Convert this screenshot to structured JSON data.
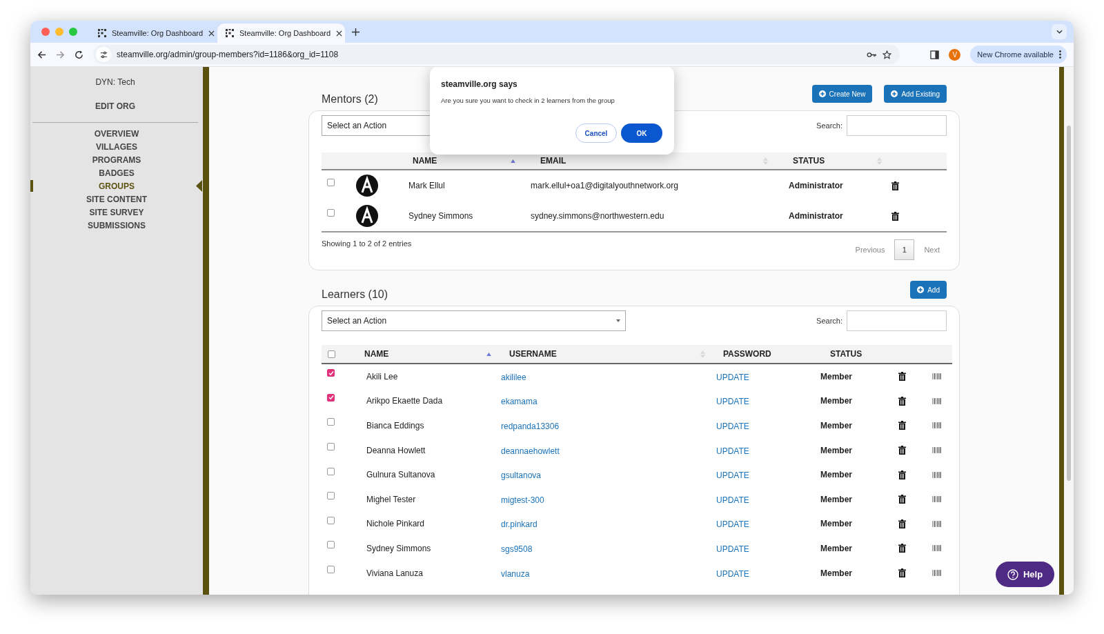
{
  "browser": {
    "tabs": [
      {
        "title": "Steamville: Org Dashboard",
        "selected": false
      },
      {
        "title": "Steamville: Org Dashboard",
        "selected": true
      }
    ],
    "url": "steamville.org/admin/group-members?id=1186&org_id=1108",
    "profile_initial": "V",
    "update_button": "New Chrome available"
  },
  "sidebar": {
    "org_name": "DYN: Tech",
    "edit_org": "EDIT ORG",
    "items": [
      {
        "label": "OVERVIEW",
        "selected": false
      },
      {
        "label": "VILLAGES",
        "selected": false
      },
      {
        "label": "PROGRAMS",
        "selected": false
      },
      {
        "label": "BADGES",
        "selected": false
      },
      {
        "label": "GROUPS",
        "selected": true
      },
      {
        "label": "SITE CONTENT",
        "selected": false
      },
      {
        "label": "SITE SURVEY",
        "selected": false
      },
      {
        "label": "SUBMISSIONS",
        "selected": false
      }
    ]
  },
  "mentors": {
    "title": "Mentors (2)",
    "buttons": [
      "Create New",
      "Add Existing"
    ],
    "action_select": {
      "placeholder": "Select an Action"
    },
    "search_label": "Search:",
    "columns": [
      {
        "label": "NAME",
        "sortable": true,
        "sorted": true
      },
      {
        "label": "EMAIL",
        "sortable": true,
        "sorted": false
      },
      {
        "label": "STATUS",
        "sortable": true,
        "sorted": false
      }
    ],
    "rows": [
      {
        "checked": false,
        "name": "Mark Ellul",
        "email": "mark.ellul+oa1@digitalyouthnetwork.org",
        "status": "Administrator"
      },
      {
        "checked": false,
        "name": "Sydney Simmons",
        "email": "sydney.simmons@northwestern.edu",
        "status": "Administrator"
      }
    ],
    "info": "Showing 1 to 2 of 2 entries",
    "pagination": {
      "previous": "Previous",
      "page": "1",
      "next": "Next"
    }
  },
  "learners": {
    "title": "Learners (10)",
    "add_button": "Add",
    "action_select": {
      "placeholder": "Select an Action"
    },
    "search_label": "Search:",
    "select_all_checked": false,
    "columns": [
      {
        "label": "NAME",
        "sortable": true,
        "sorted": true
      },
      {
        "label": "USERNAME",
        "sortable": true,
        "sorted": false
      },
      {
        "label": "PASSWORD",
        "sortable": false
      },
      {
        "label": "STATUS",
        "sortable": false
      }
    ],
    "rows": [
      {
        "checked": true,
        "name": "Akili Lee",
        "username": "akililee",
        "password": "UPDATE",
        "status": "Member"
      },
      {
        "checked": true,
        "name": "Arikpo Ekaette Dada",
        "username": "ekamama",
        "password": "UPDATE",
        "status": "Member"
      },
      {
        "checked": false,
        "name": "Bianca Eddings",
        "username": "redpanda13306",
        "password": "UPDATE",
        "status": "Member"
      },
      {
        "checked": false,
        "name": "Deanna Howlett",
        "username": "deannaehowlett",
        "password": "UPDATE",
        "status": "Member"
      },
      {
        "checked": false,
        "name": "Gulnura Sultanova",
        "username": "gsultanova",
        "password": "UPDATE",
        "status": "Member"
      },
      {
        "checked": false,
        "name": "Mighel Tester",
        "username": "migtest-300",
        "password": "UPDATE",
        "status": "Member"
      },
      {
        "checked": false,
        "name": "Nichole Pinkard",
        "username": "dr.pinkard",
        "password": "UPDATE",
        "status": "Member"
      },
      {
        "checked": false,
        "name": "Sydney Simmons",
        "username": "sgs9508",
        "password": "UPDATE",
        "status": "Member"
      },
      {
        "checked": false,
        "name": "Viviana Lanuza",
        "username": "vlanuza",
        "password": "UPDATE",
        "status": "Member"
      }
    ]
  },
  "dialog": {
    "title": "steamville.org says",
    "message": "Are you sure you want to check in 2 learners from the group",
    "cancel": "Cancel",
    "ok": "OK"
  },
  "help_button": "Help"
}
